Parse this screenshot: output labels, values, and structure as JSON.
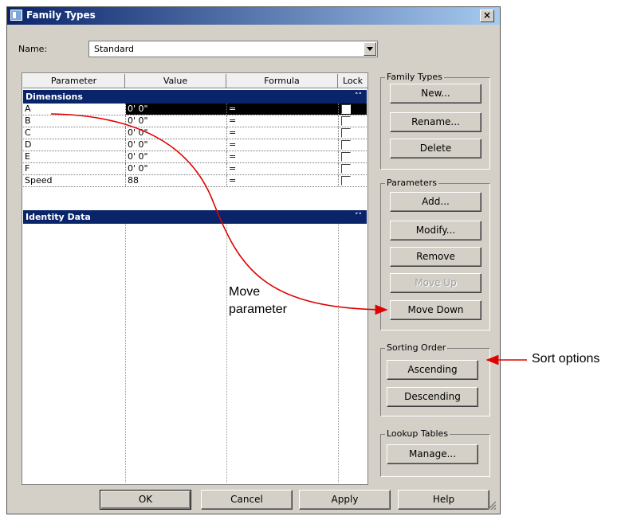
{
  "window": {
    "title": "Family Types",
    "close_symbol": "×"
  },
  "name_field": {
    "label": "Name:",
    "value": "Standard"
  },
  "table": {
    "columns": [
      "Parameter",
      "Value",
      "Formula",
      "Lock"
    ],
    "groups": [
      {
        "name": "Dimensions",
        "chevron": "˄˄"
      },
      {
        "name": "Identity Data",
        "chevron": "˅˅"
      }
    ],
    "rows": [
      {
        "parameter": "A",
        "value": "0'  0\"",
        "formula": "=",
        "selected": true
      },
      {
        "parameter": "B",
        "value": "0'  0\"",
        "formula": "="
      },
      {
        "parameter": "C",
        "value": "0'  0\"",
        "formula": "="
      },
      {
        "parameter": "D",
        "value": "0'  0\"",
        "formula": "="
      },
      {
        "parameter": "E",
        "value": "0'  0\"",
        "formula": "="
      },
      {
        "parameter": "F",
        "value": "0'  0\"",
        "formula": "="
      },
      {
        "parameter": "Speed",
        "value": "88",
        "formula": "="
      }
    ]
  },
  "family_types": {
    "title": "Family Types",
    "new": "New...",
    "rename": "Rename...",
    "delete": "Delete"
  },
  "parameters": {
    "title": "Parameters",
    "add": "Add...",
    "modify": "Modify...",
    "remove": "Remove",
    "move_up": "Move Up",
    "move_down": "Move Down"
  },
  "sorting": {
    "title": "Sorting Order",
    "ascending": "Ascending",
    "descending": "Descending"
  },
  "lookup": {
    "title": "Lookup Tables",
    "manage": "Manage..."
  },
  "footer": {
    "ok": "OK",
    "cancel": "Cancel",
    "apply": "Apply",
    "help": "Help"
  },
  "annotations": {
    "move_line1": "Move",
    "move_line2": "parameter",
    "sort": "Sort options",
    "arrow_color": "#e00000"
  }
}
